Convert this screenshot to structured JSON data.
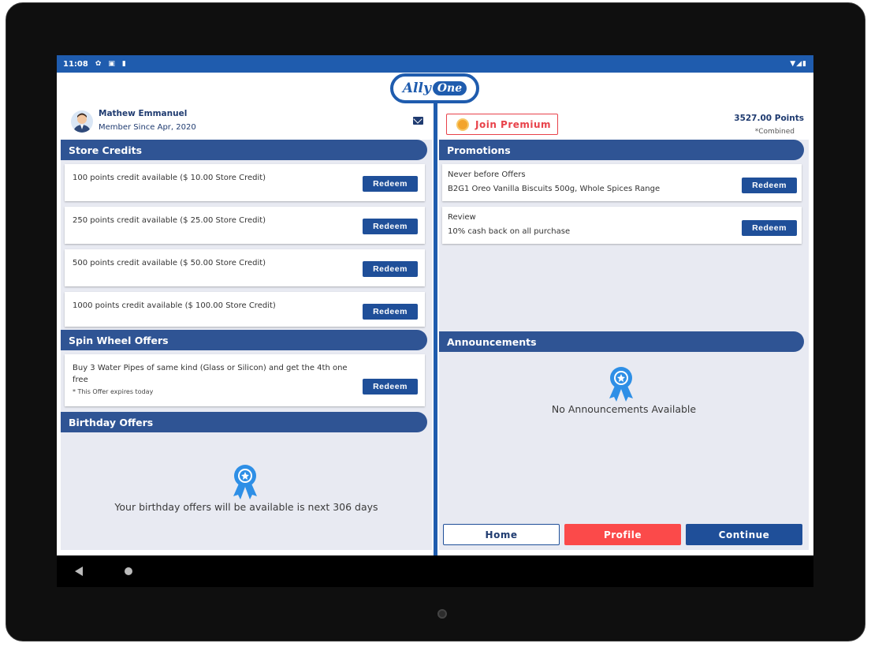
{
  "status_bar": {
    "time": "11:08",
    "icons": [
      "gear-icon",
      "photo-icon",
      "sd-card-icon"
    ],
    "right_icons": [
      "wifi-icon",
      "signal-icon",
      "battery-icon"
    ]
  },
  "logo": {
    "part1": "Ally",
    "part2": "One"
  },
  "user": {
    "name": "Mathew Emmanuel",
    "member_since": "Member Since Apr, 2020"
  },
  "premium": {
    "label": "Join Premium"
  },
  "points": {
    "value": "3527.00 Points",
    "note": "*Combined"
  },
  "store_credits": {
    "title": "Store Credits",
    "items": [
      {
        "text": "100 points credit available ($ 10.00 Store Credit)",
        "button": "Redeem"
      },
      {
        "text": "250 points credit available ($ 25.00 Store Credit)",
        "button": "Redeem"
      },
      {
        "text": "500 points credit available ($ 50.00 Store Credit)",
        "button": "Redeem"
      },
      {
        "text": "1000 points credit available ($ 100.00 Store Credit)",
        "button": "Redeem"
      }
    ]
  },
  "spin_wheel": {
    "title": "Spin Wheel Offers",
    "item": {
      "text": "Buy 3 Water Pipes of same kind (Glass or Silicon) and get the 4th one free",
      "note": "* This Offer expires today",
      "button": "Redeem"
    }
  },
  "birthday": {
    "title": "Birthday Offers",
    "message": "Your birthday offers will be available is next 306 days"
  },
  "promotions": {
    "title": "Promotions",
    "items": [
      {
        "title": "Never before Offers",
        "desc": "B2G1 Oreo Vanilla Biscuits 500g, Whole Spices Range",
        "button": "Redeem"
      },
      {
        "title": "Review",
        "desc": "10% cash back on all purchase",
        "button": "Redeem"
      }
    ]
  },
  "announcements": {
    "title": "Announcements",
    "message": "No Announcements Available"
  },
  "footer": {
    "home": "Home",
    "profile": "Profile",
    "continue": "Continue"
  },
  "colors": {
    "primary": "#1f5cae",
    "header": "#2f5494",
    "button": "#1f4f99",
    "accent_red": "#fb4a4a",
    "panel_bg": "#e8eaf2"
  }
}
